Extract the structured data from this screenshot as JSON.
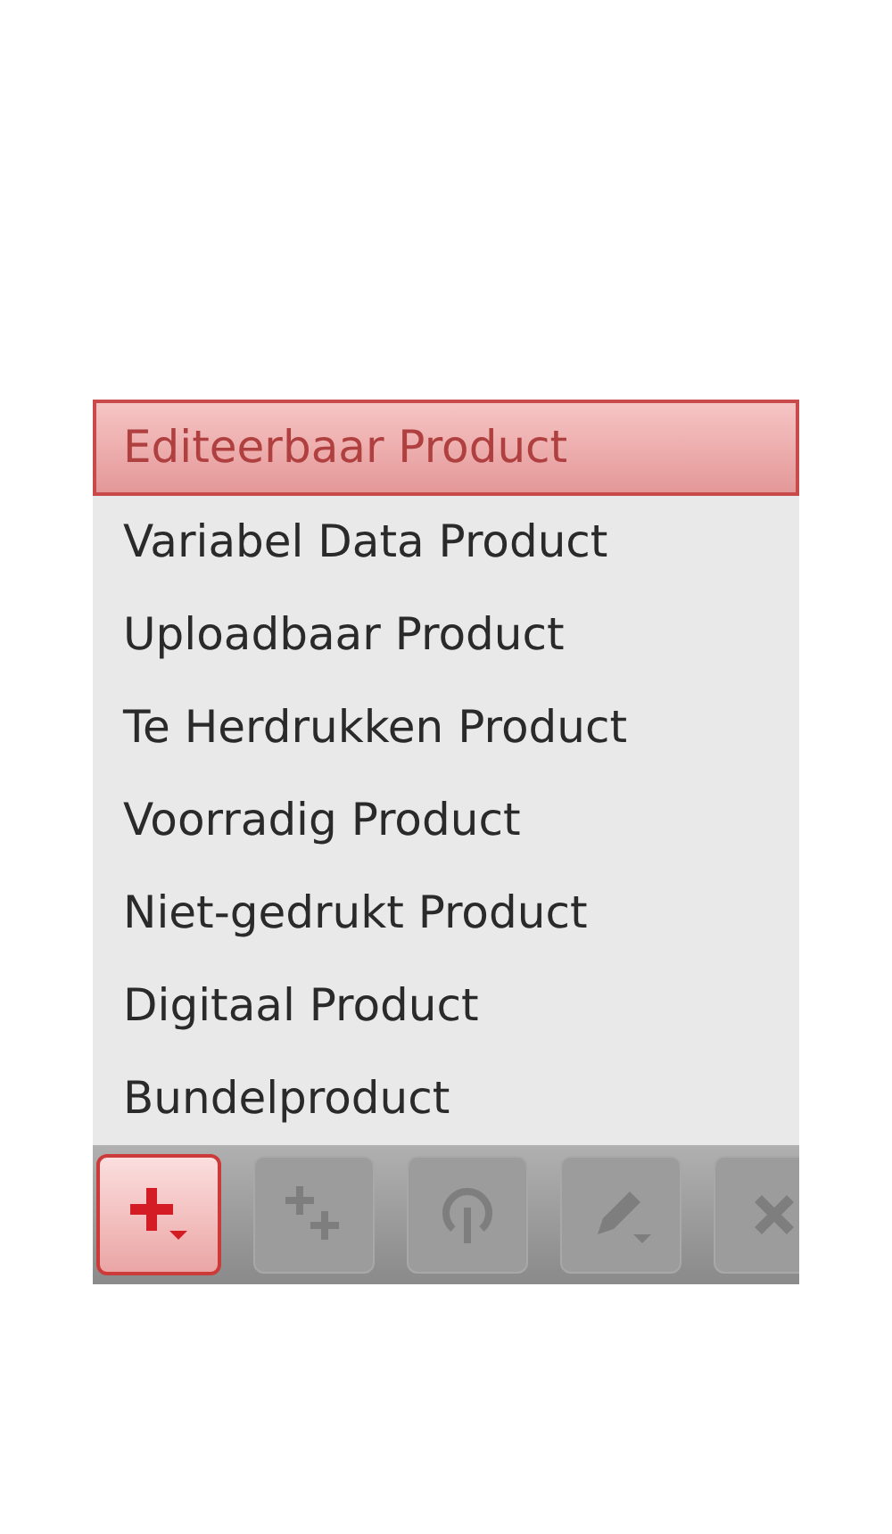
{
  "menu": {
    "items": [
      {
        "label": "Editeerbaar Product",
        "selected": true
      },
      {
        "label": "Variabel Data Product",
        "selected": false
      },
      {
        "label": "Uploadbaar Product",
        "selected": false
      },
      {
        "label": "Te Herdrukken Product",
        "selected": false
      },
      {
        "label": "Voorradig Product",
        "selected": false
      },
      {
        "label": "Niet-gedrukt Product",
        "selected": false
      },
      {
        "label": "Digitaal Product",
        "selected": false
      },
      {
        "label": "Bundelproduct",
        "selected": false
      }
    ]
  },
  "toolbar": {
    "buttons": [
      {
        "kind": "add",
        "disabled": false
      },
      {
        "kind": "add-multiple",
        "disabled": true
      },
      {
        "kind": "power",
        "disabled": true
      },
      {
        "kind": "edit",
        "disabled": true
      },
      {
        "kind": "delete",
        "disabled": true
      }
    ]
  }
}
